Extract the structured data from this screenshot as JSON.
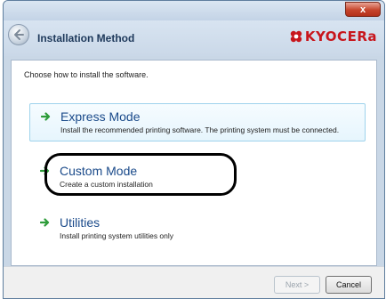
{
  "window": {
    "close_label": "x"
  },
  "header": {
    "title": "Installation Method",
    "brand": "KYOCERa"
  },
  "content": {
    "instruction": "Choose how to install the software.",
    "options": [
      {
        "title": "Express Mode",
        "description": "Install the recommended printing software. The printing system must be connected."
      },
      {
        "title": "Custom Mode",
        "description": "Create a custom installation"
      },
      {
        "title": "Utilities",
        "description": "Install printing system utilities only"
      }
    ]
  },
  "footer": {
    "next_label": "Next >",
    "cancel_label": "Cancel"
  },
  "colors": {
    "brand": "#c8161d",
    "option_arrow": "#2e9c3a",
    "option_title": "#1a4a8a",
    "selected_border": "#9fd3ec"
  }
}
